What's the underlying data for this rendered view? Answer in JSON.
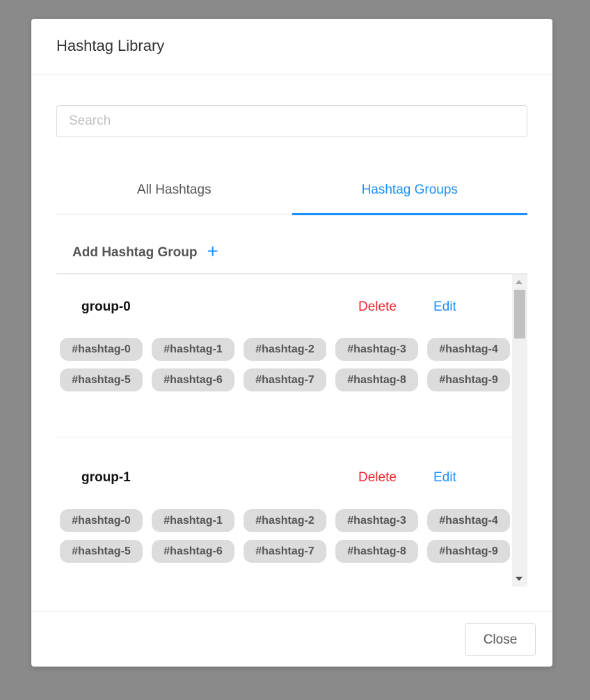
{
  "modal": {
    "title": "Hashtag Library",
    "search": {
      "placeholder": "Search",
      "value": ""
    },
    "tabs": [
      {
        "label": "All Hashtags",
        "active": false
      },
      {
        "label": "Hashtag Groups",
        "active": true
      }
    ],
    "add_group_label": "Add Hashtag Group",
    "add_icon": "plus-icon",
    "groups": [
      {
        "name": "group-0",
        "delete_label": "Delete",
        "edit_label": "Edit",
        "tags": [
          "#hashtag-0",
          "#hashtag-1",
          "#hashtag-2",
          "#hashtag-3",
          "#hashtag-4",
          "#hashtag-5",
          "#hashtag-6",
          "#hashtag-7",
          "#hashtag-8",
          "#hashtag-9"
        ]
      },
      {
        "name": "group-1",
        "delete_label": "Delete",
        "edit_label": "Edit",
        "tags": [
          "#hashtag-0",
          "#hashtag-1",
          "#hashtag-2",
          "#hashtag-3",
          "#hashtag-4",
          "#hashtag-5",
          "#hashtag-6",
          "#hashtag-7",
          "#hashtag-8",
          "#hashtag-9"
        ]
      }
    ],
    "close_label": "Close"
  },
  "colors": {
    "accent": "#1890ff",
    "danger": "#f5222d",
    "overlay": "#8a8a8a",
    "tag_bg": "#dcdcdc"
  }
}
